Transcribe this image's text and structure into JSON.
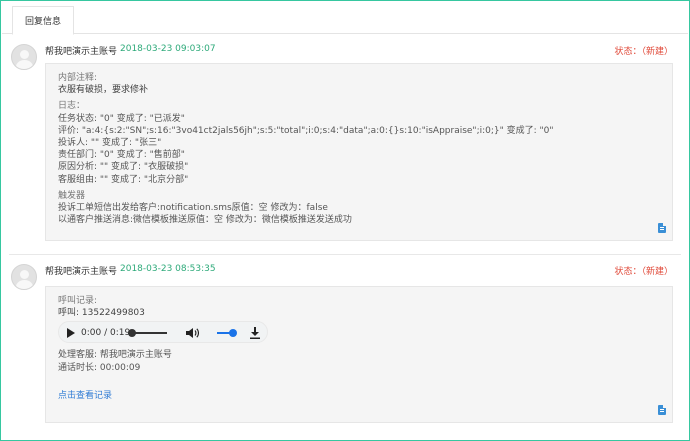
{
  "tabs": [
    {
      "label": "回复信息"
    }
  ],
  "entries": [
    {
      "author": "帮我吧演示主账号",
      "time": "2018-03-23 09:03:07",
      "status": "状态：（新建）",
      "lines": [
        "内部注释:",
        "衣服有破损，要求修补",
        "日志：",
        "任务状态: \"0\" 变成了: \"已派发\"",
        "评价: \"a:4:{s:2:\"SN\";s:16:\"3vo41ct2jals56jh\";s:5:\"total\";i:0;s:4:\"data\";a:0:{}s:10:\"isAppraise\";i:0;}\" 变成了: \"0\"",
        "投诉人: \"\" 变成了: \"张三\"",
        "责任部门: \"0\" 变成了: \"售前部\"",
        "原因分析: \"\" 变成了: \"衣服破损\"",
        "客服组由: \"\" 变成了: \"北京分部\"",
        "触发器",
        "投诉工单短信出发给客户:notification.sms原值：空  修改为：false",
        "以通客户推送消息:微信模板推送原值：空  修改为：微信模板推送发送成功"
      ]
    },
    {
      "author": "帮我吧演示主账号",
      "time": "2018-03-23 08:53:35",
      "status": "状态：（新建）",
      "call_label": "呼叫记录:",
      "call_number": "呼叫: 13522499803",
      "player": {
        "time": "0:00 / 0:19",
        "progress": 0,
        "volume": 1
      },
      "agent": "处理客服: 帮我吧演示主账号",
      "duration": "通话时长: 00:00:09",
      "link": "点击查看记录"
    }
  ],
  "colors": {
    "accent": "#36c7a0",
    "time": "#2eaa7a",
    "status": "#e04a3a",
    "link": "#2f7bd4"
  },
  "icons": {
    "play": "play-icon",
    "volume": "volume-icon",
    "download": "download-icon",
    "document": "document-icon"
  }
}
